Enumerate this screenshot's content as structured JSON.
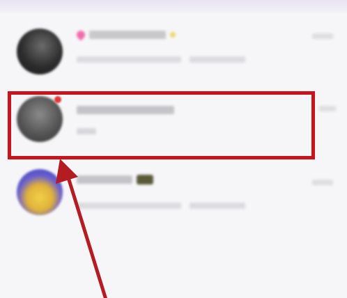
{
  "conversations": [
    {
      "name": "",
      "preview": "",
      "time": "",
      "has_heart_icon": true,
      "has_sparkle_icon": true,
      "avatar_color": "#3d3d3d"
    },
    {
      "name": "",
      "preview": "",
      "time": "",
      "has_red_dot": true,
      "avatar_color": "#5a5a5a",
      "highlighted": true
    },
    {
      "name": "",
      "preview": "",
      "time": "",
      "has_badge": true,
      "avatar_color": "#3a5bd0"
    }
  ],
  "annotation": {
    "box_color": "#c8141c",
    "arrow_color": "#b51c22",
    "box_target": "conversation 2"
  },
  "colors": {
    "background": "#f6f6f8",
    "top_strip": "#e9e3f4"
  }
}
